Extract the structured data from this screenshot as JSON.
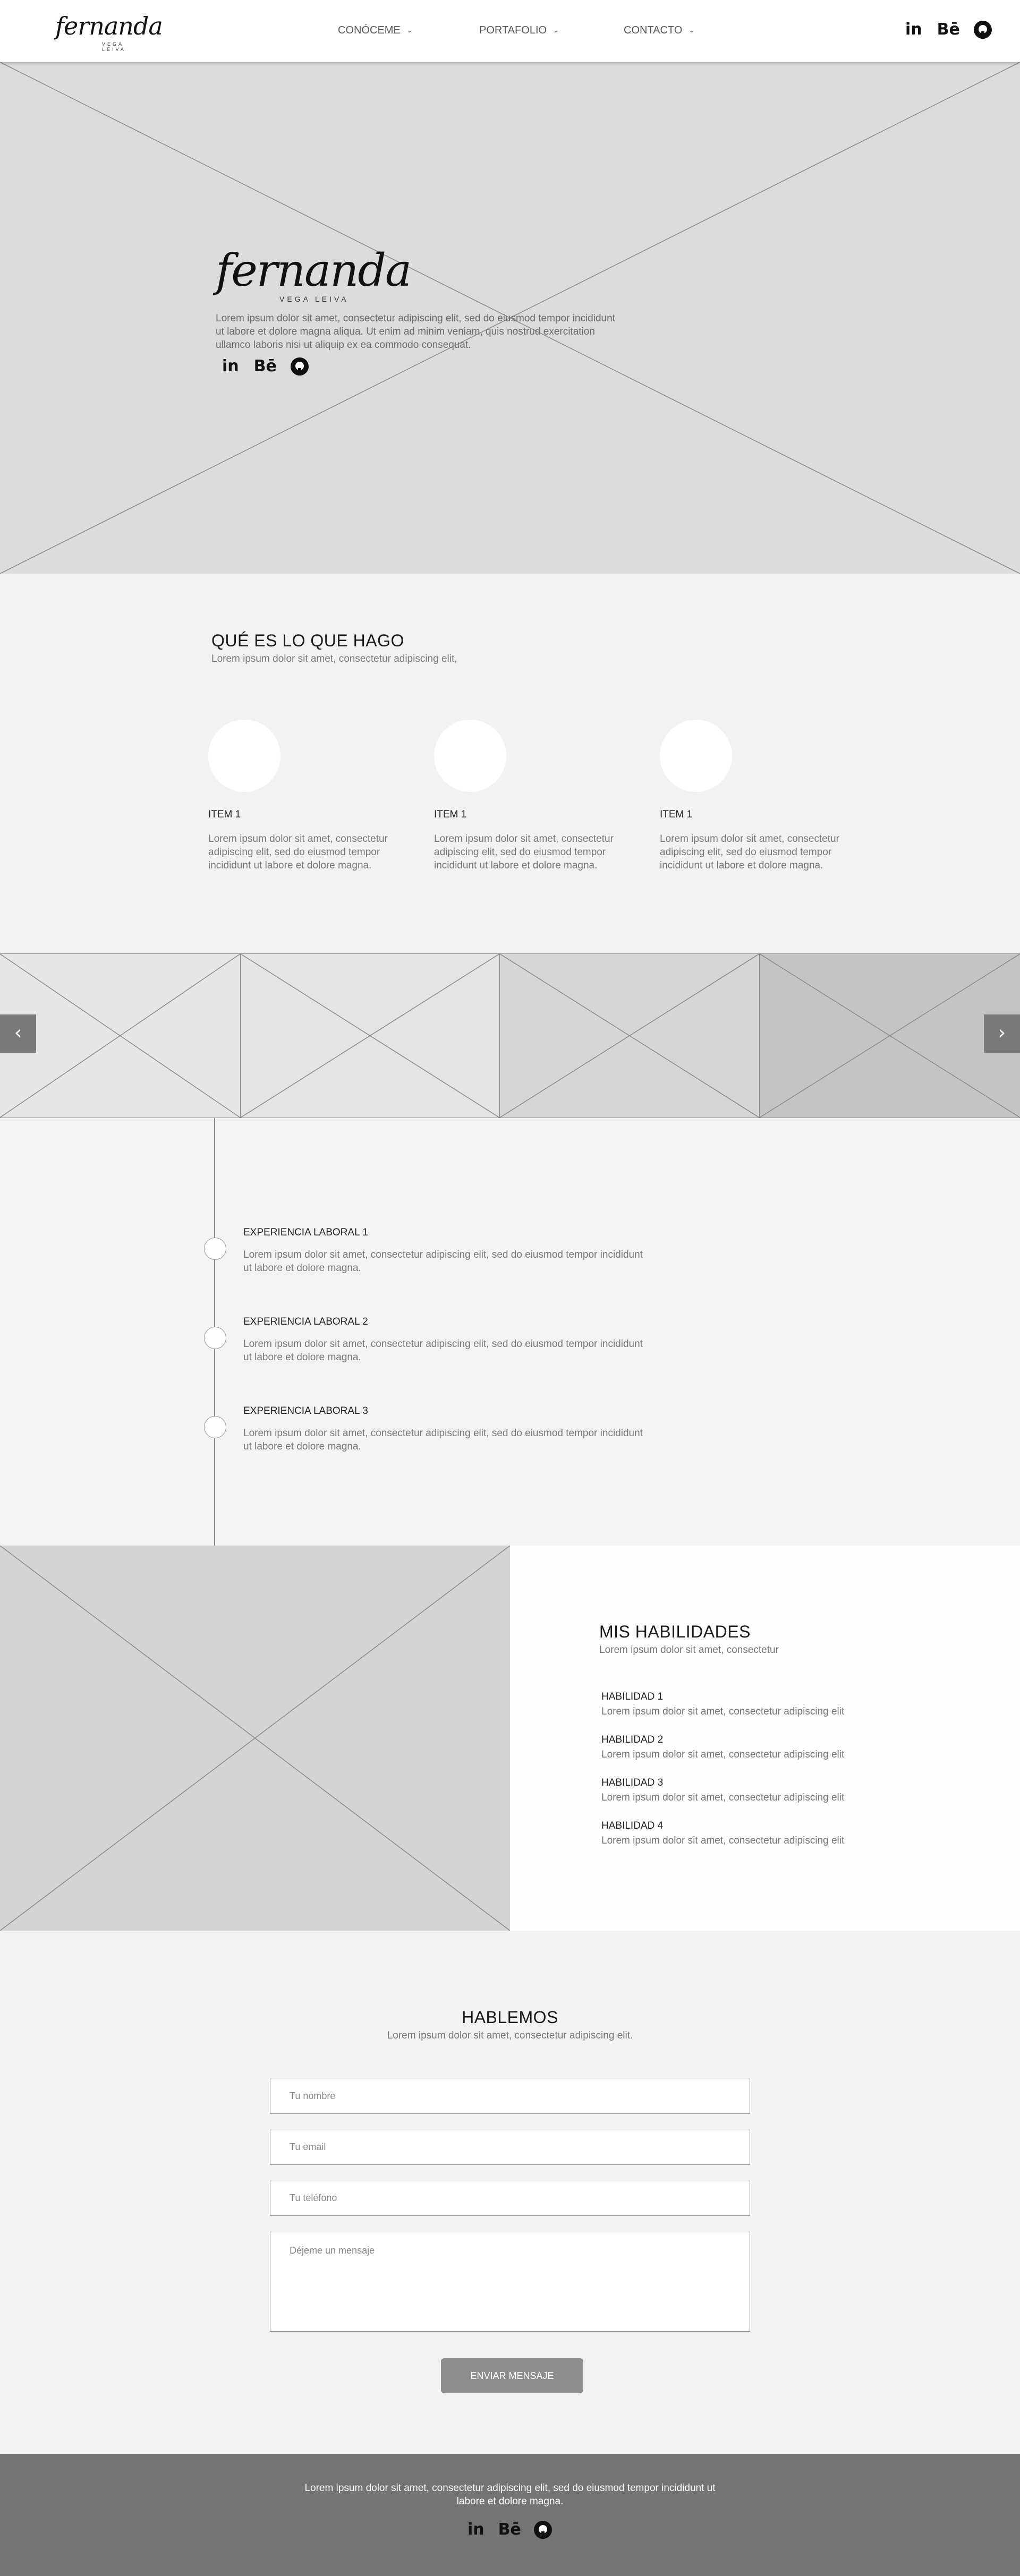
{
  "header": {
    "logo_script": "fernanda",
    "logo_sub": "VEGA LEIVA",
    "nav": [
      {
        "label": "CONÓCEME"
      },
      {
        "label": "PORTAFOLIO"
      },
      {
        "label": "CONTACTO"
      }
    ],
    "chevron": "⌄",
    "social": {
      "linkedin": "in",
      "behance": "Bē"
    }
  },
  "hero": {
    "logo_script": "fernanda",
    "logo_sub": "VEGA LEIVA",
    "text": "Lorem ipsum dolor sit amet, consectetur adipiscing elit, sed do eiusmod tempor incididunt ut labore et dolore magna aliqua. Ut enim ad minim veniam, quis nostrud exercitation ullamco laboris nisi ut aliquip ex ea commodo consequat.",
    "social": {
      "linkedin": "in",
      "behance": "Bē"
    }
  },
  "what": {
    "title": "QUÉ ES LO QUE HAGO",
    "subtitle": "Lorem ipsum dolor sit amet, consectetur adipiscing elit,",
    "items": [
      {
        "title": "ITEM 1",
        "desc": "Lorem ipsum dolor sit amet, consectetur adipiscing elit, sed do eiusmod tempor incididunt ut labore et dolore magna."
      },
      {
        "title": "ITEM 1",
        "desc": "Lorem ipsum dolor sit amet, consectetur adipiscing elit, sed do eiusmod tempor incididunt ut labore et dolore magna."
      },
      {
        "title": "ITEM 1",
        "desc": "Lorem ipsum dolor sit amet, consectetur adipiscing elit, sed do eiusmod tempor incididunt ut labore et dolore magna."
      }
    ]
  },
  "carousel": {
    "prev": "‹",
    "next": "›"
  },
  "timeline": [
    {
      "title": "EXPERIENCIA LABORAL 1",
      "desc": "Lorem ipsum dolor sit amet, consectetur adipiscing elit, sed do eiusmod tempor incididunt ut labore et dolore magna."
    },
    {
      "title": "EXPERIENCIA LABORAL 2",
      "desc": "Lorem ipsum dolor sit amet, consectetur adipiscing elit, sed do eiusmod tempor incididunt ut labore et dolore magna."
    },
    {
      "title": "EXPERIENCIA LABORAL 3",
      "desc": "Lorem ipsum dolor sit amet, consectetur adipiscing elit, sed do eiusmod tempor incididunt ut labore et dolore magna."
    }
  ],
  "skills": {
    "title": "MIS HABILIDADES",
    "subtitle": "Lorem ipsum dolor sit amet, consectetur",
    "items": [
      {
        "title": "HABILIDAD 1",
        "desc": "Lorem ipsum dolor sit amet, consectetur adipiscing elit"
      },
      {
        "title": "HABILIDAD 2",
        "desc": "Lorem ipsum dolor sit amet, consectetur adipiscing elit"
      },
      {
        "title": "HABILIDAD 3",
        "desc": "Lorem ipsum dolor sit amet, consectetur adipiscing elit"
      },
      {
        "title": "HABILIDAD 4",
        "desc": "Lorem ipsum dolor sit amet, consectetur adipiscing elit"
      }
    ]
  },
  "contact": {
    "title": "HABLEMOS",
    "subtitle": "Lorem ipsum dolor sit amet, consectetur adipiscing elit.",
    "name_placeholder": "Tu nombre",
    "email_placeholder": "Tu email",
    "phone_placeholder": "Tu teléfono",
    "message_placeholder": "Déjeme un mensaje",
    "submit_label": "ENVIAR MENSAJE"
  },
  "footer": {
    "text": "Lorem ipsum dolor sit amet, consectetur adipiscing elit, sed do eiusmod tempor incididunt ut labore et dolore magna.",
    "social": {
      "linkedin": "in",
      "behance": "Bē"
    }
  }
}
